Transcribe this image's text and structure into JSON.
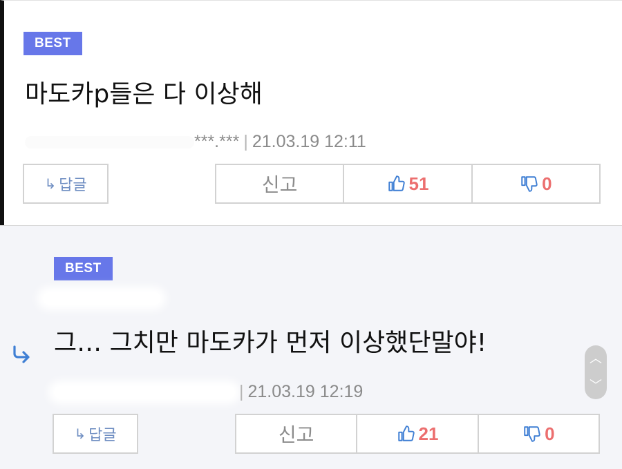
{
  "comments": [
    {
      "badge": "BEST",
      "text": "마도카p들은 다 이상해",
      "ip": "***.***",
      "separator": "|",
      "timestamp": "21.03.19 12:11",
      "reply_label": "답글",
      "report_label": "신고",
      "likes": "51",
      "dislikes": "0"
    },
    {
      "badge": "BEST",
      "text": "그… 그치만 마도카가 먼저 이상했단말야!",
      "separator": "|",
      "timestamp": "21.03.19 12:19",
      "reply_label": "답글",
      "report_label": "신고",
      "likes": "21",
      "dislikes": "0"
    }
  ],
  "icons": {
    "reply_arrow": "reply-arrow-icon",
    "thumbs_up": "thumbs-up-icon",
    "thumbs_down": "thumbs-down-icon",
    "scroll_up": "chevron-up-icon",
    "scroll_down": "chevron-down-icon"
  },
  "colors": {
    "badge": "#6777e9",
    "like_count": "#ec6f6f",
    "icon_blue": "#3f7fd4",
    "reply_bg": "#f4f5f9"
  }
}
